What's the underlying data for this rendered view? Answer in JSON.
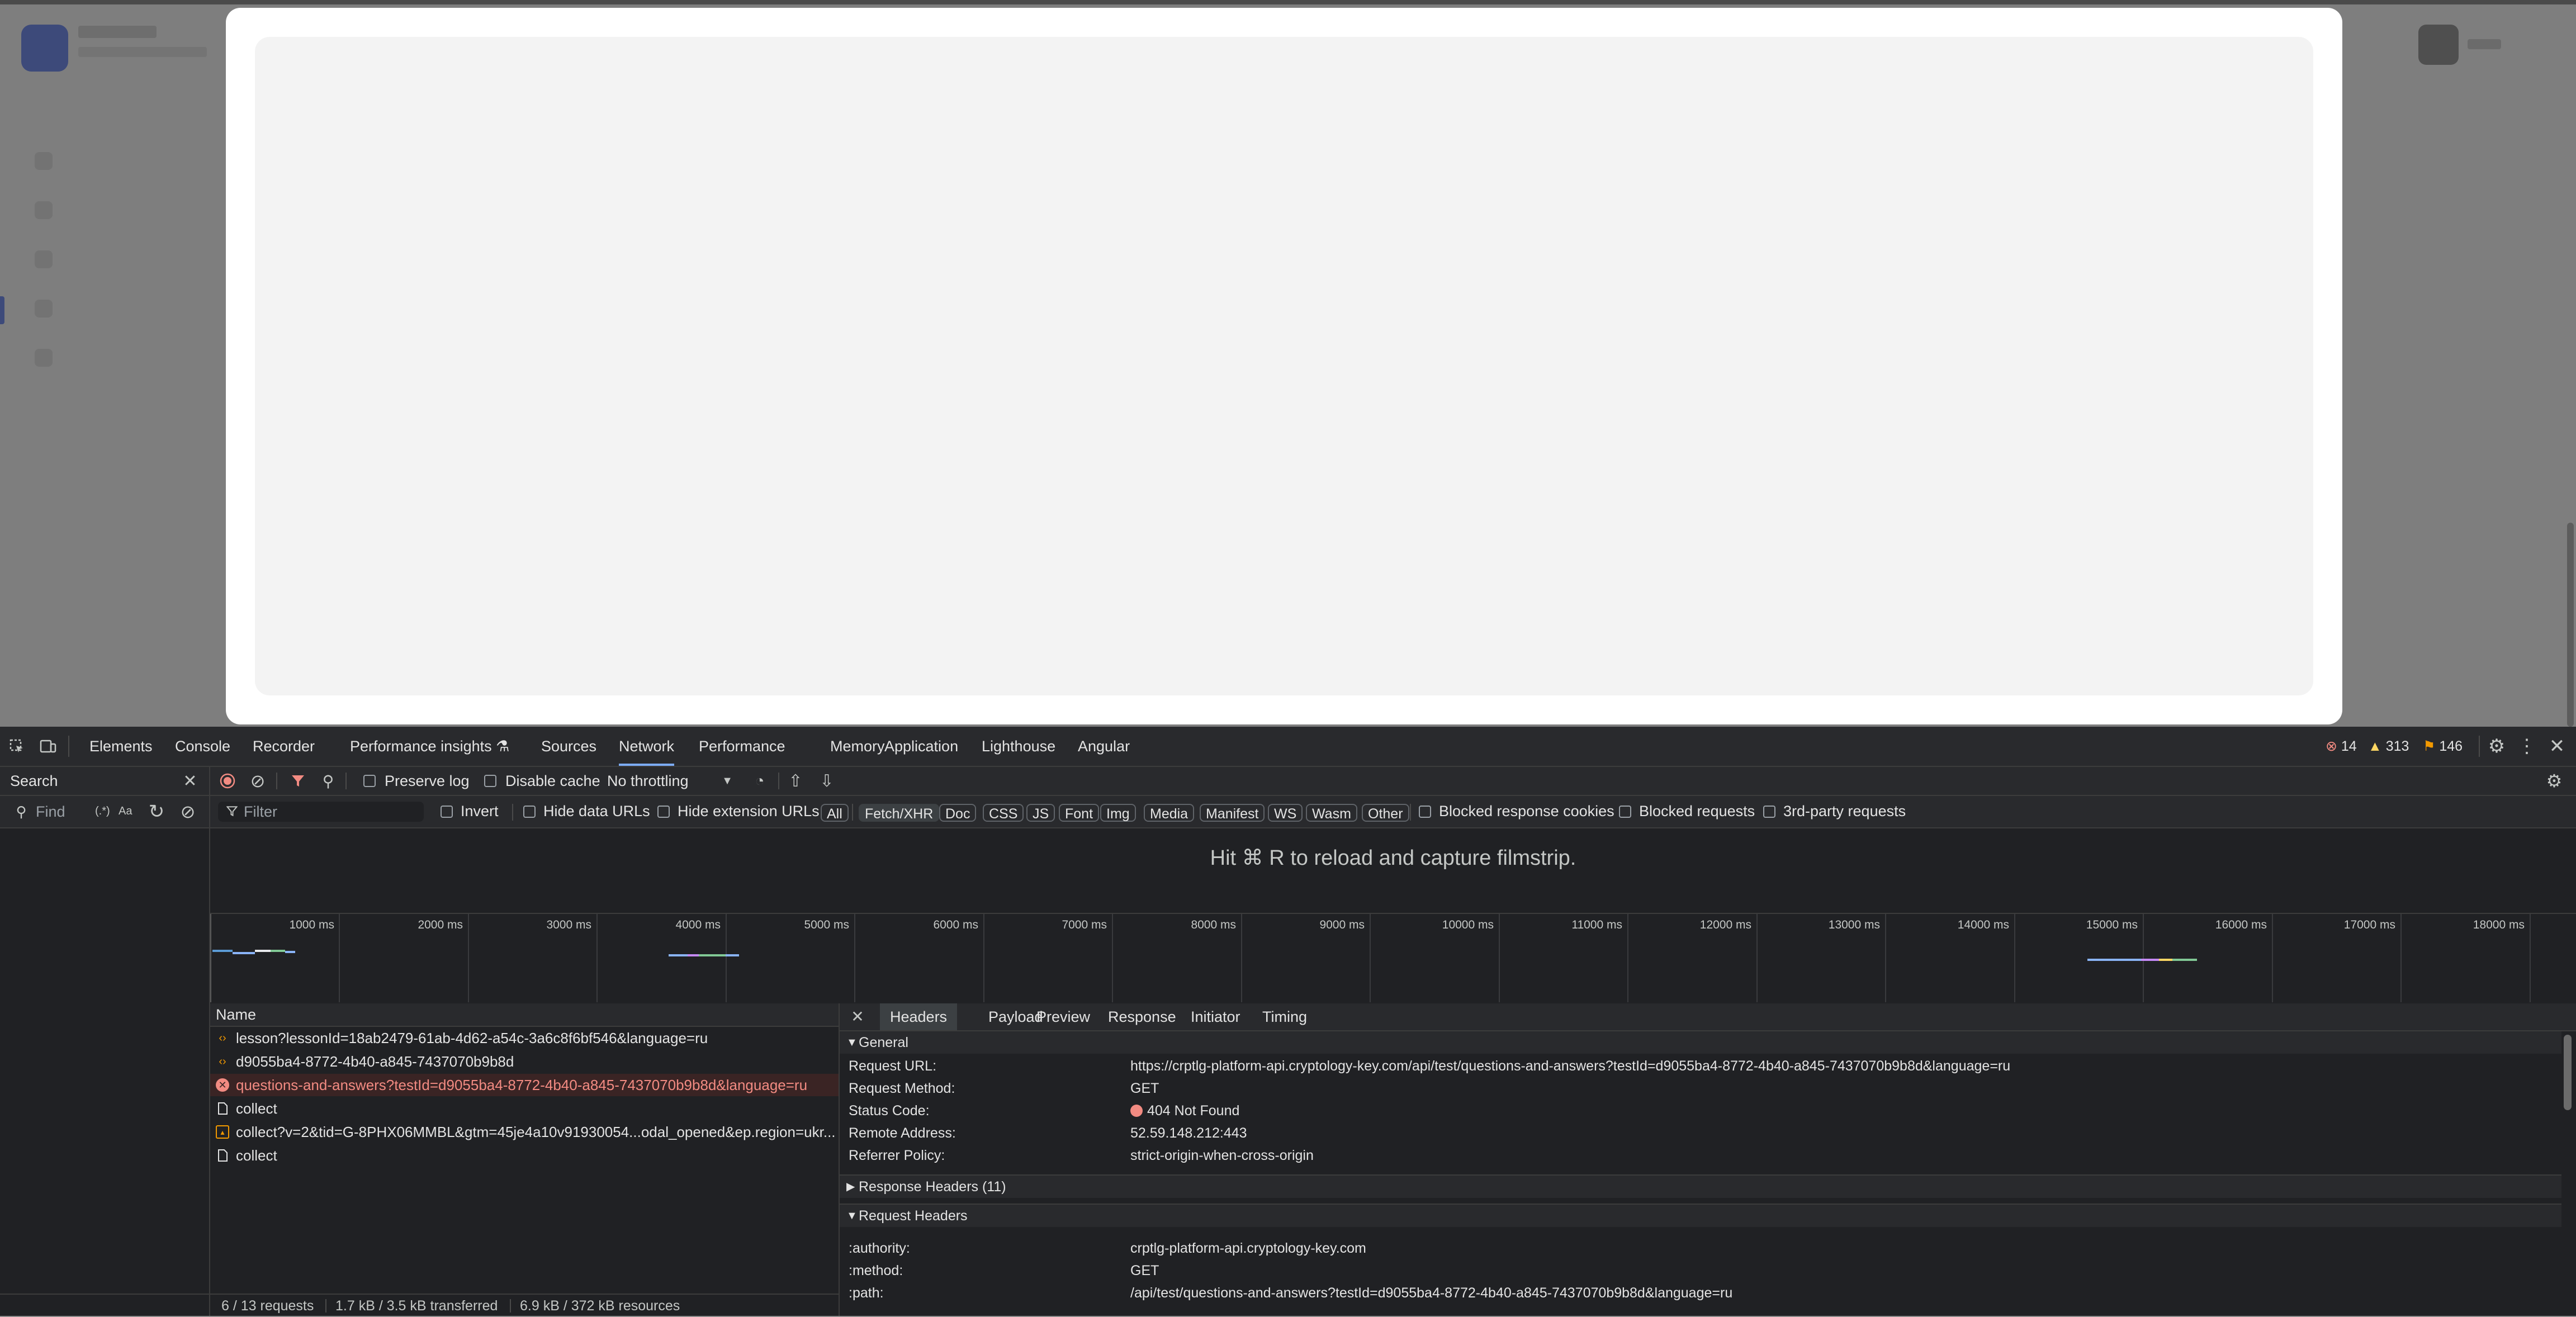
{
  "devtools": {
    "tabs": [
      "Elements",
      "Console",
      "Recorder",
      "Performance insights",
      "Sources",
      "Network",
      "Performance",
      "Memory",
      "Application",
      "Lighthouse",
      "Angular"
    ],
    "active_tab": "Network",
    "counts": {
      "errors": "14",
      "warnings": "313",
      "issues": "146"
    },
    "colors": {
      "error": "#f28b82",
      "warning": "#fdd663",
      "issue": "#f29900",
      "accent": "#7cacf8"
    }
  },
  "search_pane": {
    "title": "Search",
    "find_placeholder": "Find",
    "regex_label": "(.*)",
    "case_label": "Aa"
  },
  "toolbar": {
    "preserve_log": "Preserve log",
    "disable_cache": "Disable cache",
    "throttling": "No throttling"
  },
  "filter_bar": {
    "placeholder": "Filter",
    "invert": "Invert",
    "hide_data_urls": "Hide data URLs",
    "hide_extension_urls": "Hide extension URLs",
    "types": [
      "All",
      "Fetch/XHR",
      "Doc",
      "CSS",
      "JS",
      "Font",
      "Img",
      "Media",
      "Manifest",
      "WS",
      "Wasm",
      "Other"
    ],
    "active_type": "Fetch/XHR",
    "blocked_cookies": "Blocked response cookies",
    "blocked_requests": "Blocked requests",
    "third_party": "3rd-party requests"
  },
  "filmstrip_message": "Hit ⌘ R to reload and capture filmstrip.",
  "overview_ticks": [
    "1000 ms",
    "2000 ms",
    "3000 ms",
    "4000 ms",
    "5000 ms",
    "6000 ms",
    "7000 ms",
    "8000 ms",
    "9000 ms",
    "10000 ms",
    "11000 ms",
    "12000 ms",
    "13000 ms",
    "14000 ms",
    "15000 ms",
    "16000 ms",
    "17000 ms",
    "18000 ms"
  ],
  "requests": {
    "column_name": "Name",
    "rows": [
      {
        "name": "lesson?lessonId=18ab2479-61ab-4d62-a54c-3a6c8f6bf546&language=ru",
        "icon": "xhr-icon"
      },
      {
        "name": "d9055ba4-8772-4b40-a845-7437070b9b8d",
        "icon": "xhr-icon"
      },
      {
        "name": "questions-and-answers?testId=d9055ba4-8772-4b40-a845-7437070b9b8d&language=ru",
        "icon": "error-icon"
      },
      {
        "name": "collect",
        "icon": "document-icon"
      },
      {
        "name": "collect?v=2&tid=G-8PHX06MMBL&gtm=45je4a10v91930054...odal_opened&ep.region=ukr...",
        "icon": "image-icon"
      },
      {
        "name": "collect",
        "icon": "document-icon"
      }
    ],
    "selected_index": 2,
    "summary": {
      "requests": "6 / 13 requests",
      "transferred": "1.7 kB / 3.5 kB transferred",
      "resources": "6.9 kB / 372 kB resources"
    }
  },
  "details": {
    "tabs": [
      "Headers",
      "Payload",
      "Preview",
      "Response",
      "Initiator",
      "Timing"
    ],
    "active_tab": "Headers",
    "general_title": "General",
    "general": [
      {
        "key": "Request URL:",
        "value": "https://crptlg-platform-api.cryptology-key.com/api/test/questions-and-answers?testId=d9055ba4-8772-4b40-a845-7437070b9b8d&language=ru"
      },
      {
        "key": "Request Method:",
        "value": "GET"
      },
      {
        "key": "Status Code:",
        "value": "404 Not Found"
      },
      {
        "key": "Remote Address:",
        "value": "52.59.148.212:443"
      },
      {
        "key": "Referrer Policy:",
        "value": "strict-origin-when-cross-origin"
      }
    ],
    "response_headers_title": "Response Headers (11)",
    "request_headers_title": "Request Headers",
    "request_headers": [
      {
        "key": ":authority:",
        "value": "crptlg-platform-api.cryptology-key.com"
      },
      {
        "key": ":method:",
        "value": "GET"
      },
      {
        "key": ":path:",
        "value": "/api/test/questions-and-answers?testId=d9055ba4-8772-4b40-a845-7437070b9b8d&language=ru"
      }
    ]
  }
}
